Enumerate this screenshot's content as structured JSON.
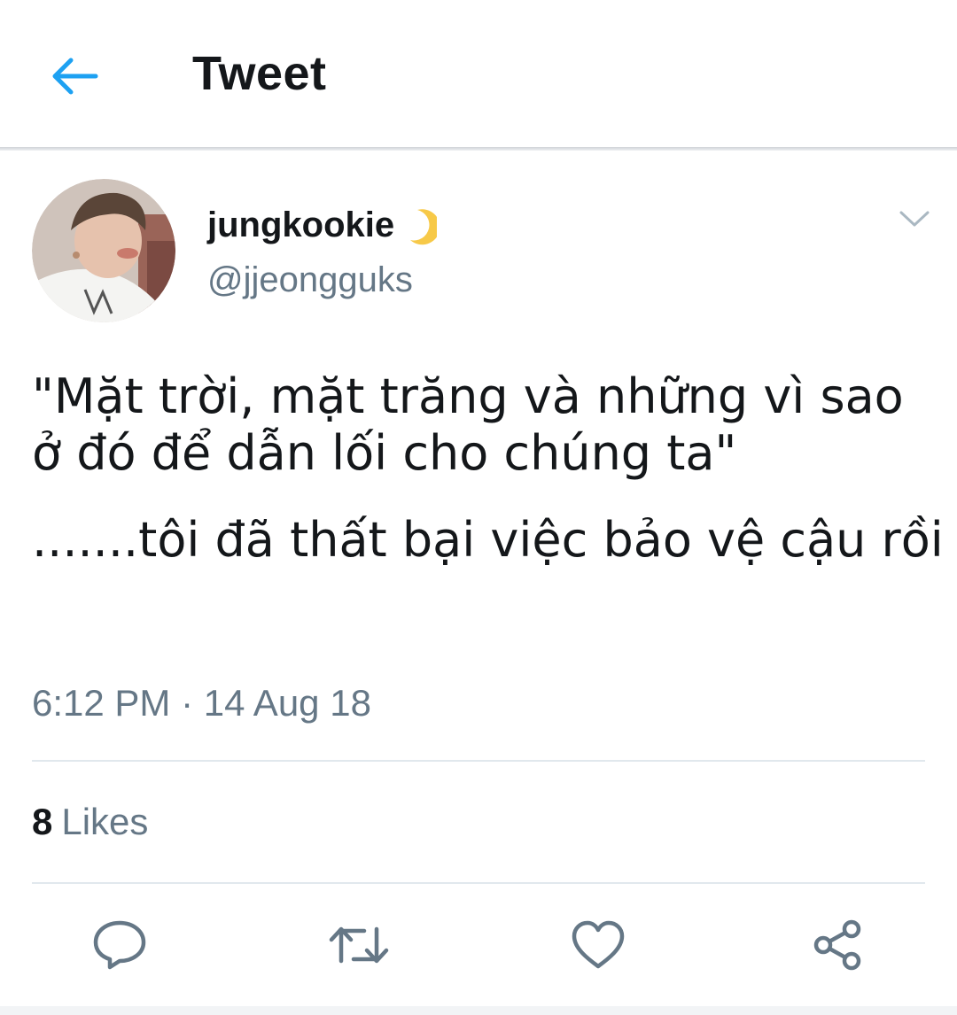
{
  "header": {
    "title": "Tweet",
    "back_icon": "arrow-left-icon",
    "accent_color": "#1da1f2"
  },
  "tweet": {
    "author": {
      "name": "jungkookie",
      "name_emoji": "crescent-moon-icon",
      "handle": "@jjeongguks"
    },
    "text_paragraphs": [
      "\"Mặt trời, mặt trăng và những vì sao ở đó để dẫn lối cho chúng ta\"",
      ".......tôi đã thất bại việc bảo vệ cậu rồi"
    ],
    "timestamp": "6:12 PM · 14 Aug 18",
    "likes": {
      "count": "8",
      "label": "Likes"
    }
  },
  "actions": [
    {
      "name": "reply",
      "icon": "reply-icon"
    },
    {
      "name": "retweet",
      "icon": "retweet-icon"
    },
    {
      "name": "like",
      "icon": "heart-icon"
    },
    {
      "name": "share",
      "icon": "share-icon"
    }
  ],
  "colors": {
    "text_primary": "#14171a",
    "text_secondary": "#657786",
    "divider": "#e1e8ed"
  }
}
